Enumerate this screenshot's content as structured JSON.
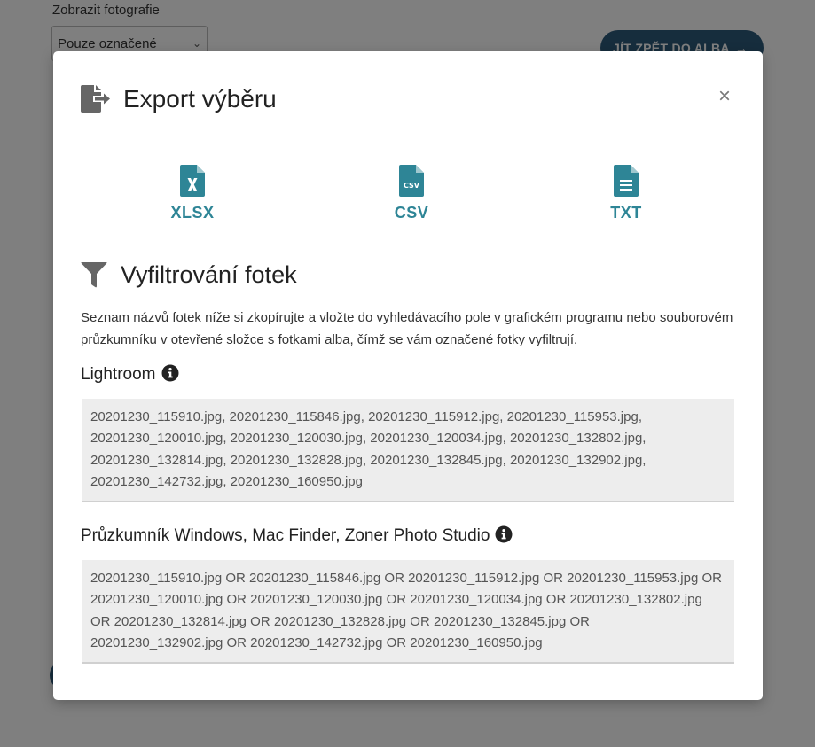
{
  "background": {
    "show_photos_label": "Zobrazit fotografie",
    "show_photos_value": "Pouze označené",
    "back_button_label": "JÍT ZPĚT DO ALBA"
  },
  "modal": {
    "title": "Export výběru",
    "close_label": "×",
    "formats": [
      {
        "label": "XLSX",
        "icon": "file-excel-icon"
      },
      {
        "label": "CSV",
        "icon": "file-csv-icon"
      },
      {
        "label": "TXT",
        "icon": "file-text-icon"
      }
    ],
    "filter_title": "Vyfiltrování fotek",
    "filter_description": "Seznam názvů fotek níže si zkopírujte a vložte do vyhledávacího pole v grafickém programu nebo souborovém průzkumníku v otevřené složce s fotkami alba, čímž se vám označené fotky vyfiltrují.",
    "lightroom": {
      "heading": "Lightroom",
      "list": "20201230_115910.jpg, 20201230_115846.jpg, 20201230_115912.jpg, 20201230_115953.jpg, 20201230_120010.jpg, 20201230_120030.jpg, 20201230_120034.jpg, 20201230_132802.jpg, 20201230_132814.jpg, 20201230_132828.jpg, 20201230_132845.jpg, 20201230_132902.jpg, 20201230_142732.jpg, 20201230_160950.jpg"
    },
    "explorer": {
      "heading": "Průzkumník Windows, Mac Finder, Zoner Photo Studio",
      "list": "20201230_115910.jpg OR 20201230_115846.jpg OR 20201230_115912.jpg OR 20201230_115953.jpg OR 20201230_120010.jpg OR 20201230_120030.jpg OR 20201230_120034.jpg OR 20201230_132802.jpg OR 20201230_132814.jpg OR 20201230_132828.jpg OR 20201230_132845.jpg OR 20201230_132902.jpg OR 20201230_142732.jpg OR 20201230_160950.jpg"
    }
  },
  "colors": {
    "accent": "#2e8596",
    "button_dark": "#2c5a7a",
    "icon_gray": "#666666",
    "list_bg": "#ededed"
  }
}
